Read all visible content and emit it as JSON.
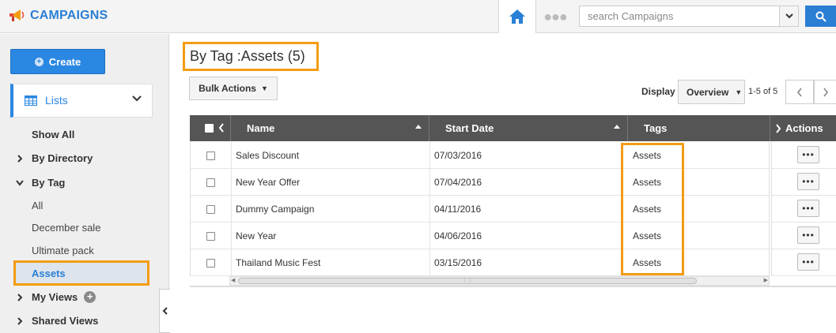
{
  "app": {
    "name": "CAMPAIGNS",
    "brand_color": "#2a7fd4",
    "accent_color": "#f39c12"
  },
  "topbar": {
    "home_icon": "home-icon",
    "more_icon": "ellipsis-icon",
    "search_placeholder": "search Campaigns",
    "search_icon": "search-icon"
  },
  "sidebar": {
    "create_label": "Create",
    "lists_label": "Lists",
    "show_all": "Show All",
    "by_directory": "By Directory",
    "by_tag": "By Tag",
    "tags": [
      "All",
      "December sale",
      "Ultimate pack",
      "Assets"
    ],
    "my_views": "My Views",
    "shared_views": "Shared Views"
  },
  "main": {
    "title": "By Tag :Assets (5)",
    "bulk_actions": "Bulk Actions",
    "display_label": "Display",
    "display_value": "Overview",
    "pager_text": "1-5 of 5"
  },
  "table": {
    "columns": {
      "name": "Name",
      "start_date": "Start Date",
      "tags": "Tags",
      "actions": "Actions"
    },
    "rows": [
      {
        "name": "Sales Discount",
        "start_date": "07/03/2016",
        "tags": "Assets"
      },
      {
        "name": "New Year Offer",
        "start_date": "07/04/2016",
        "tags": "Assets"
      },
      {
        "name": "Dummy Campaign",
        "start_date": "04/11/2016",
        "tags": "Assets"
      },
      {
        "name": "New Year",
        "start_date": "04/06/2016",
        "tags": "Assets"
      },
      {
        "name": "Thailand Music Fest",
        "start_date": "03/15/2016",
        "tags": "Assets"
      }
    ],
    "row_action_label": "•••"
  }
}
